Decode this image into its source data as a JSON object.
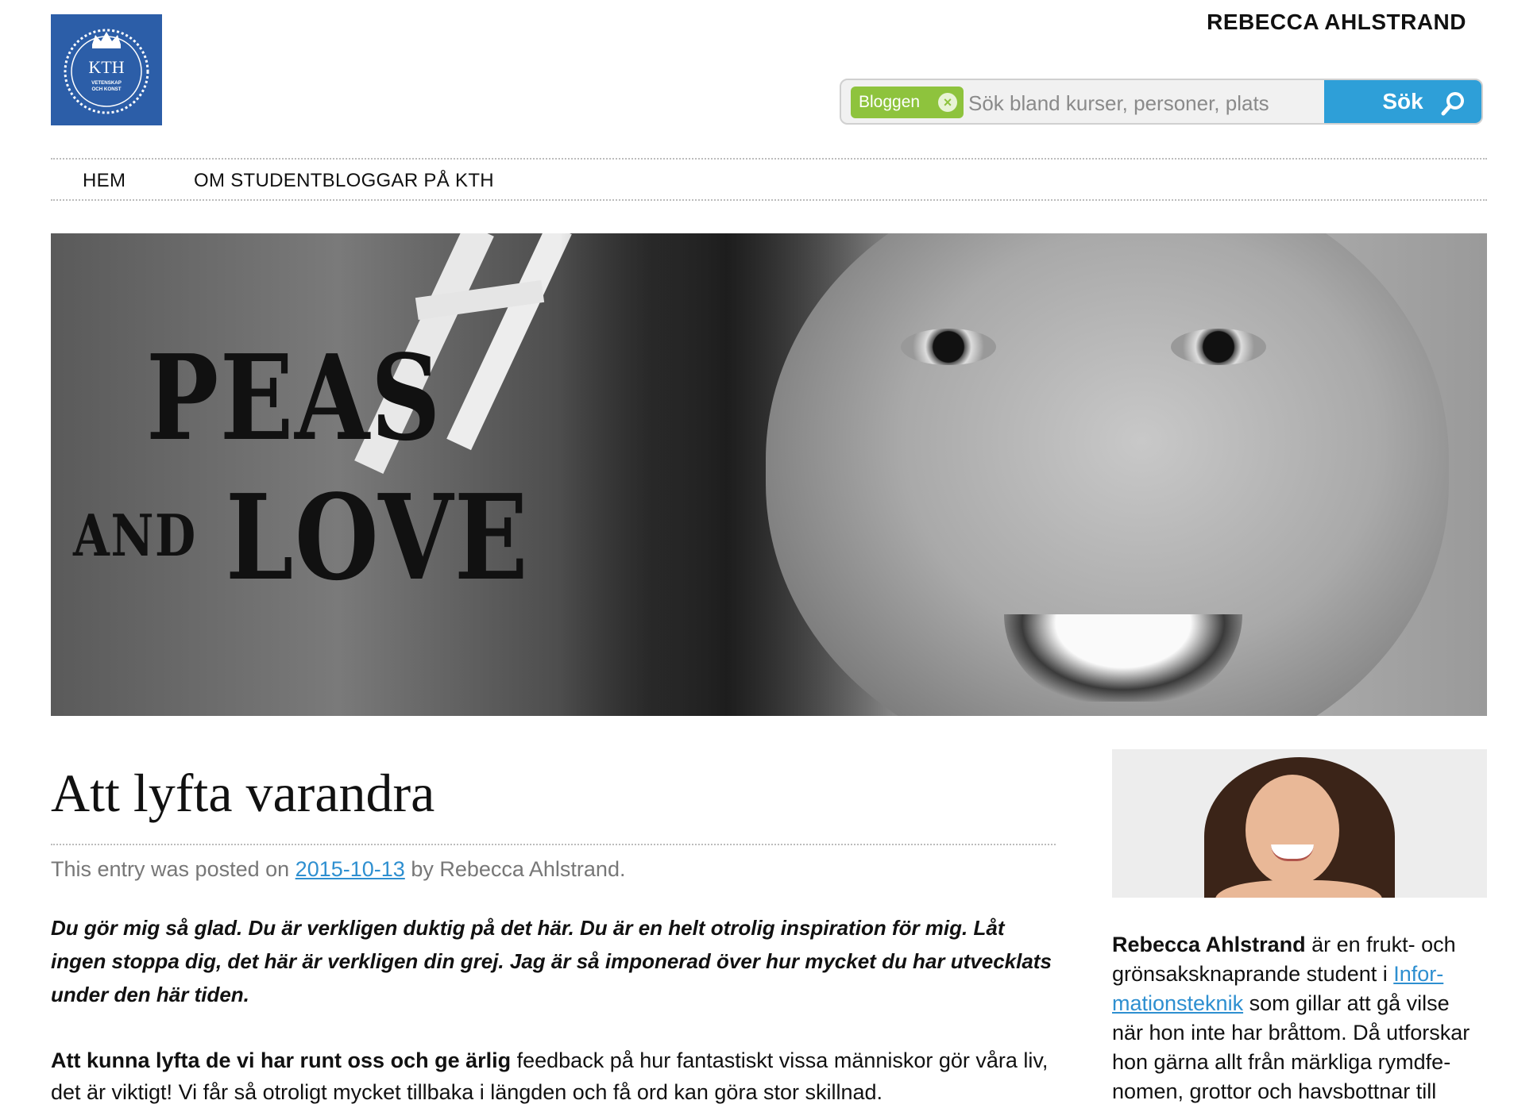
{
  "header": {
    "logo_text": "KTH",
    "logo_subtext": "VETENSKAP OCH KONST",
    "user_name": "REBECCA AHLSTRAND"
  },
  "search": {
    "scope_tag": "Bloggen",
    "placeholder": "Sök bland kurser, personer, plats",
    "button_label": "Sök"
  },
  "nav": {
    "items": [
      "HEM",
      "OM STUDENTBLOGGAR PÅ KTH"
    ]
  },
  "banner": {
    "line1": "PEAS",
    "line2_small": "AND",
    "line2_big": "LOVE"
  },
  "post": {
    "title": "Att lyfta varandra",
    "meta_prefix": "This entry was posted on",
    "date": "2015-10-13",
    "meta_suffix": "by Rebecca Ahlstrand.",
    "quote": "Du gör mig så glad. Du är verkligen duktig på det här. Du är en helt otrolig inspiration för mig. Låt ingen stoppa dig, det här är verkligen din grej. Jag är så imponerad över hur mycket du har utvecklats under den här tiden.",
    "para_bold": "Att kunna lyfta de vi har runt oss och ge ärlig",
    "para_rest": " feedback på hur fantastiskt vissa människor gör våra liv, det är viktigt! Vi får så otroligt mycket tillbaka i längden och få ord kan göra stor skillnad."
  },
  "sidebar": {
    "author_name": "Rebecca Ahlstrand",
    "bio_part1": " är en frukt- och grönsaksknaprande student i ",
    "bio_link": "Infor-mationsteknik",
    "bio_part2": " som gillar att gå vilse när hon inte har bråttom. Då utforskar hon gärna allt från märkliga rymdfe-nomen, grottor och havsbottnar till"
  },
  "colors": {
    "kth_blue": "#2c5ea8",
    "search_blue": "#2e9fd8",
    "tag_green": "#8ec33d",
    "link_blue": "#2e8fd0"
  }
}
